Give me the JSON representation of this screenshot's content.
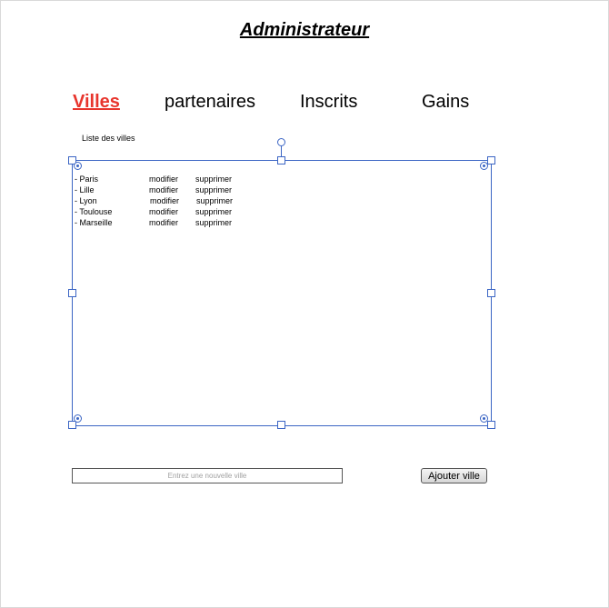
{
  "page": {
    "title": "Administrateur"
  },
  "tabs": [
    {
      "label": "Villes",
      "active": true
    },
    {
      "label": "partenaires",
      "active": false
    },
    {
      "label": "Inscrits",
      "active": false
    },
    {
      "label": "Gains",
      "active": false
    }
  ],
  "cities": {
    "label": "Liste des villes",
    "rows": [
      {
        "name": "- Paris",
        "edit": "modifier",
        "delete": "supprimer"
      },
      {
        "name": "- Lille",
        "edit": "modifier",
        "delete": "supprimer"
      },
      {
        "name": "- Lyon",
        "edit": "modifier",
        "delete": "supprimer"
      },
      {
        "name": "- Toulouse",
        "edit": "modifier",
        "delete": "supprimer"
      },
      {
        "name": "- Marseille",
        "edit": "modifier",
        "delete": "supprimer"
      }
    ]
  },
  "add_form": {
    "input_value": "",
    "input_placeholder": "Entrez une nouvelle ville",
    "button_label": "Ajouter ville"
  },
  "colors": {
    "active_tab": "#e8352d",
    "selection": "#3b65c4"
  }
}
